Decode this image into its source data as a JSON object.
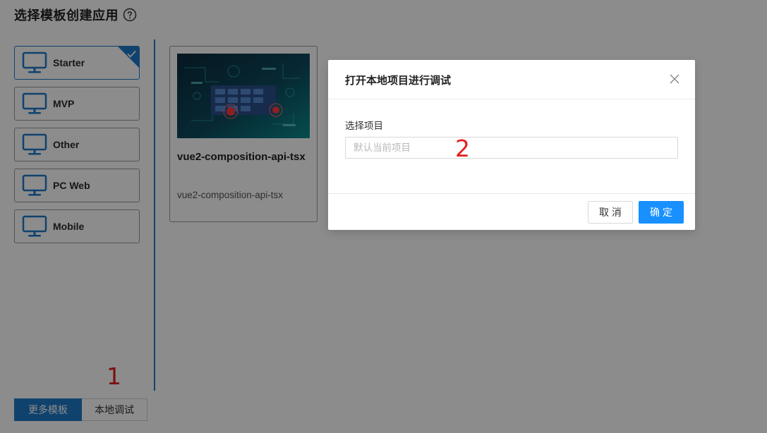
{
  "page": {
    "title": "选择模板创建应用"
  },
  "categories": [
    {
      "label": "Starter",
      "icon": "monitor-icon",
      "selected": true
    },
    {
      "label": "MVP",
      "icon": "monitor-icon",
      "selected": false
    },
    {
      "label": "Other",
      "icon": "monitor-icon",
      "selected": false
    },
    {
      "label": "PC Web",
      "icon": "monitor-icon",
      "selected": false
    },
    {
      "label": "Mobile",
      "icon": "monitor-icon",
      "selected": false
    }
  ],
  "template_card": {
    "title": "vue2-composition-api-tsx",
    "subtitle": "vue2-composition-api-tsx"
  },
  "bottom_buttons": {
    "more_label": "更多模板",
    "local_label": "本地调试"
  },
  "annotations": {
    "marker_1": "1",
    "marker_2": "2"
  },
  "modal": {
    "title": "打开本地项目进行调试",
    "field_label": "选择项目",
    "input_placeholder": "默认当前项目",
    "input_value": "",
    "cancel_label": "取 消",
    "ok_label": "确 定"
  },
  "colors": {
    "primary": "#1890ff",
    "accent_blue": "#1e78c8",
    "annotation_red": "#e02020",
    "overlay": "rgba(0,0,0,0.45)"
  }
}
